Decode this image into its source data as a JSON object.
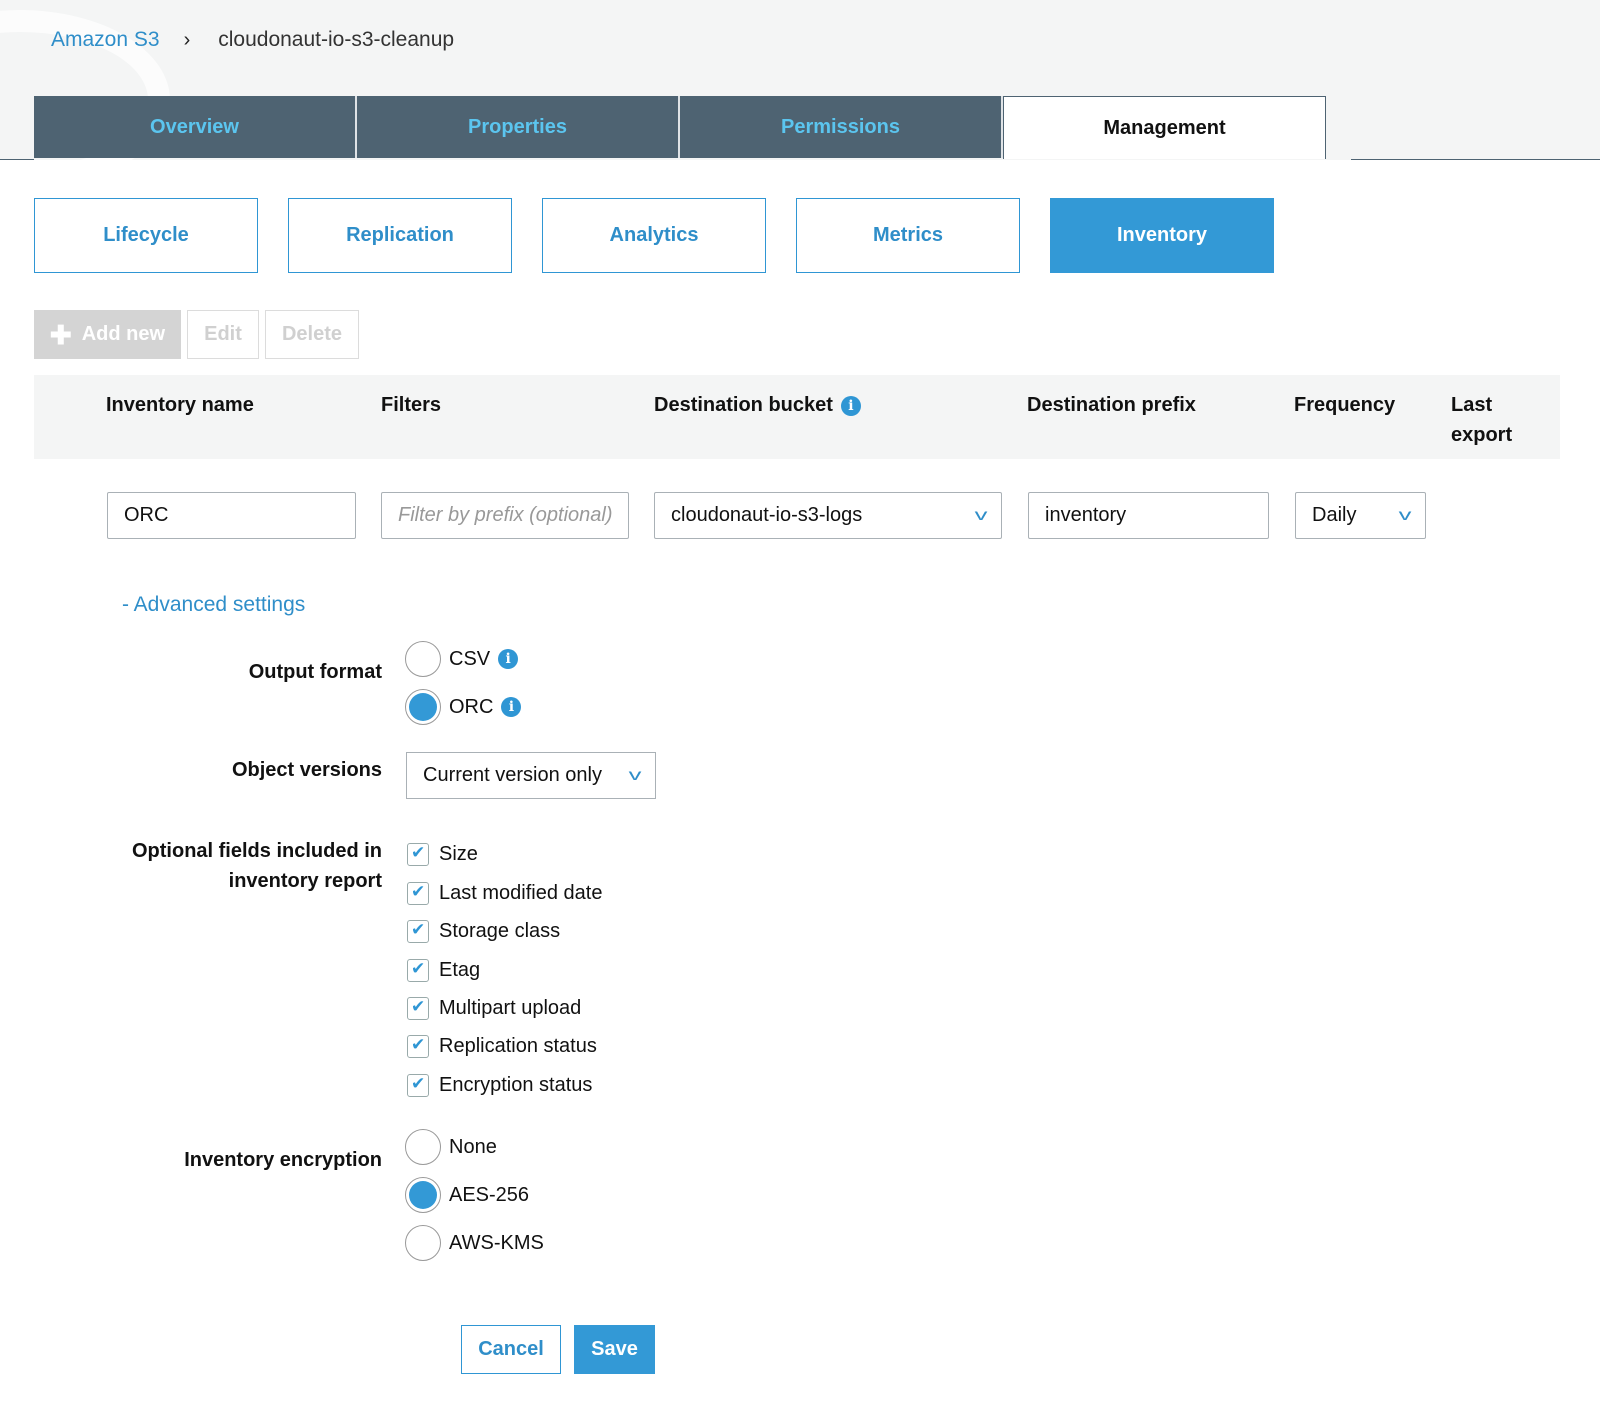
{
  "breadcrumb": {
    "root": "Amazon S3",
    "separator": "›",
    "current": "cloudonaut-io-s3-cleanup"
  },
  "tabs": [
    {
      "label": "Overview",
      "active": false
    },
    {
      "label": "Properties",
      "active": false
    },
    {
      "label": "Permissions",
      "active": false
    },
    {
      "label": "Management",
      "active": true
    }
  ],
  "subtabs": [
    {
      "label": "Lifecycle",
      "active": false
    },
    {
      "label": "Replication",
      "active": false
    },
    {
      "label": "Analytics",
      "active": false
    },
    {
      "label": "Metrics",
      "active": false
    },
    {
      "label": "Inventory",
      "active": true
    }
  ],
  "actions": {
    "add_new": "Add new",
    "edit": "Edit",
    "delete": "Delete"
  },
  "table": {
    "headers": {
      "inventory_name": "Inventory name",
      "filters": "Filters",
      "destination_bucket": "Destination bucket",
      "destination_prefix": "Destination prefix",
      "frequency": "Frequency",
      "last_export": "Last export"
    },
    "row": {
      "inventory_name": "ORC",
      "filter_placeholder": "Filter by prefix (optional)",
      "destination_bucket": "cloudonaut-io-s3-logs",
      "destination_prefix": "inventory",
      "frequency": "Daily"
    }
  },
  "advanced": {
    "toggle_label": "- Advanced settings",
    "output_format": {
      "label": "Output format",
      "options": [
        {
          "label": "CSV",
          "selected": false
        },
        {
          "label": "ORC",
          "selected": true
        }
      ]
    },
    "object_versions": {
      "label": "Object versions",
      "value": "Current version only"
    },
    "optional_fields": {
      "label_line1": "Optional fields included in",
      "label_line2": "inventory report",
      "items": [
        {
          "label": "Size",
          "checked": true
        },
        {
          "label": "Last modified date",
          "checked": true
        },
        {
          "label": "Storage class",
          "checked": true
        },
        {
          "label": "Etag",
          "checked": true
        },
        {
          "label": "Multipart upload",
          "checked": true
        },
        {
          "label": "Replication status",
          "checked": true
        },
        {
          "label": "Encryption status",
          "checked": true
        }
      ]
    },
    "encryption": {
      "label": "Inventory encryption",
      "options": [
        {
          "label": "None",
          "selected": false
        },
        {
          "label": "AES-256",
          "selected": true
        },
        {
          "label": "AWS-KMS",
          "selected": false
        }
      ]
    }
  },
  "buttons": {
    "cancel": "Cancel",
    "save": "Save"
  },
  "colors": {
    "accent": "#3399d6",
    "tab_bg": "#4e6372",
    "tab_text": "#5bc5ef"
  }
}
